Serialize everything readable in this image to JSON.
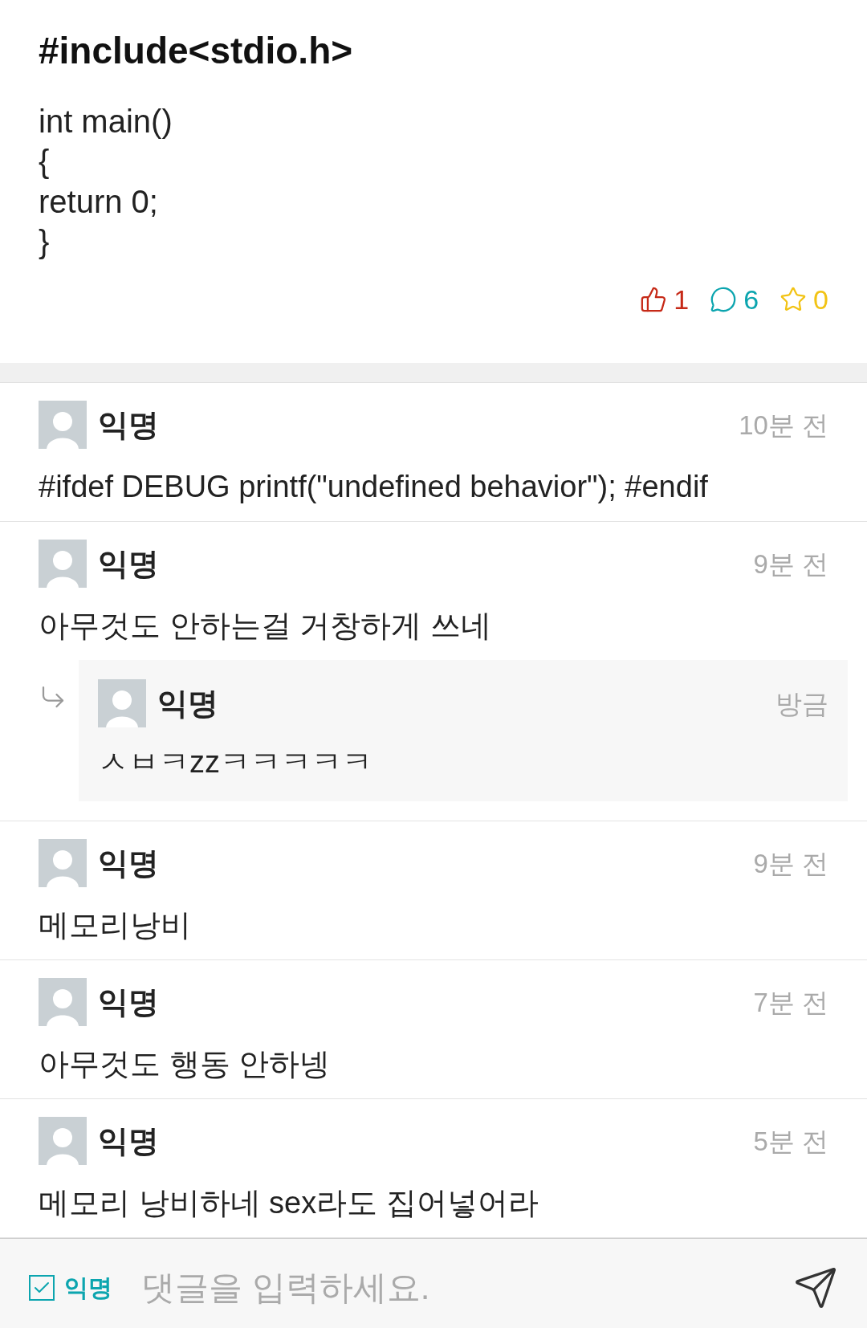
{
  "post": {
    "title": "#include<stdio.h>",
    "body_lines": [
      "int main()",
      "{",
      "return 0;",
      "}"
    ],
    "stats": {
      "likes": "1",
      "comments": "6",
      "scraps": "0"
    }
  },
  "comments": [
    {
      "name": "익명",
      "time": "10분 전",
      "text": "#ifdef DEBUG printf(\"undefined behavior\"); #endif"
    },
    {
      "name": "익명",
      "time": "9분 전",
      "text": "아무것도 안하는걸 거창하게 쓰네",
      "replies": [
        {
          "name": "익명",
          "time": "방금",
          "text": "ㅅㅂㅋzzㅋㅋㅋㅋㅋ"
        }
      ]
    },
    {
      "name": "익명",
      "time": "9분 전",
      "text": "메모리낭비"
    },
    {
      "name": "익명",
      "time": "7분 전",
      "text": "아무것도 행동 안하넹"
    },
    {
      "name": "익명",
      "time": "5분 전",
      "text": "메모리 낭비하네 sex라도 집어넣어라"
    }
  ],
  "composer": {
    "anonymous": {
      "label": "익명",
      "checked": true
    },
    "placeholder": "댓글을 입력하세요."
  }
}
